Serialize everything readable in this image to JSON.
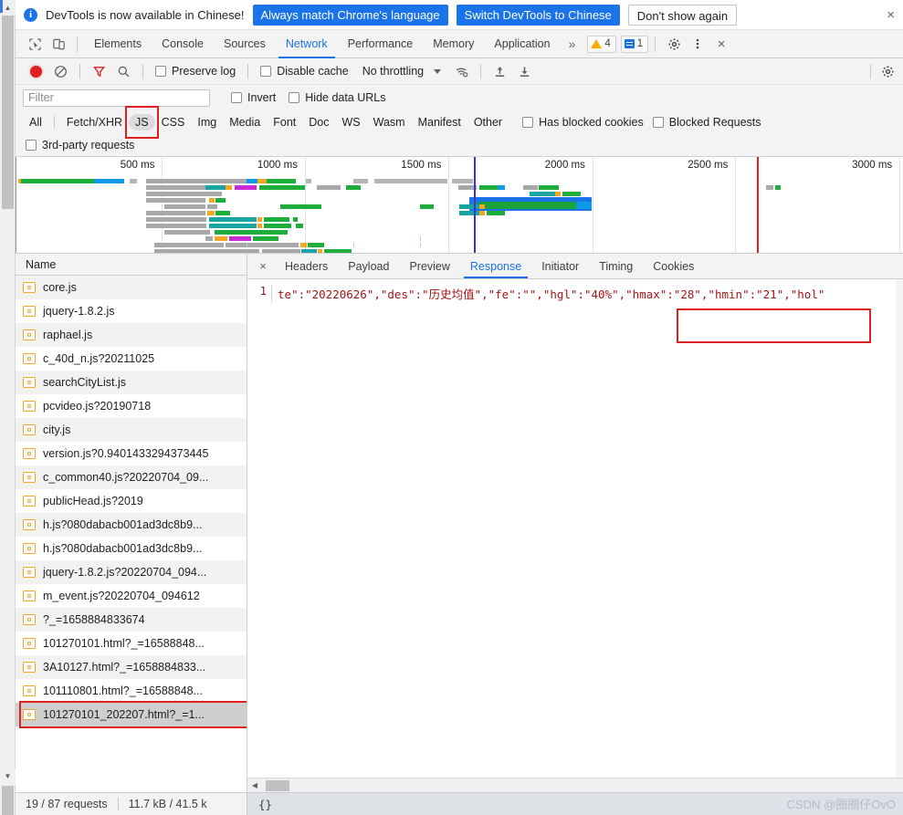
{
  "notification": {
    "icon": "info-icon",
    "message": "DevTools is now available in Chinese!",
    "primary_button": "Always match Chrome's language",
    "secondary_button": "Switch DevTools to Chinese",
    "dismiss_button": "Don't show again",
    "close_icon": "×",
    "accent_color": "#1a73e8"
  },
  "panel_tabs": {
    "inspect_icon": "inspect-cursor-icon",
    "device_icon": "device-toolbar-icon",
    "items": [
      {
        "label": "Elements",
        "active": false
      },
      {
        "label": "Console",
        "active": false
      },
      {
        "label": "Sources",
        "active": false
      },
      {
        "label": "Network",
        "active": true
      },
      {
        "label": "Performance",
        "active": false
      },
      {
        "label": "Memory",
        "active": false
      },
      {
        "label": "Application",
        "active": false
      }
    ],
    "more_icon": "chevron-double-right-icon",
    "warning_count": "4",
    "message_count": "1",
    "settings_icon": "gear-icon",
    "kebab_icon": "more-vertical-icon",
    "close_icon": "×"
  },
  "network_controls": {
    "record_icon": "record-button",
    "clear_icon": "clear-icon",
    "filter_icon": "filter-funnel-icon",
    "search_icon": "search-icon",
    "preserve_log_label": "Preserve log",
    "preserve_log_checked": false,
    "disable_cache_label": "Disable cache",
    "disable_cache_checked": false,
    "throttling_value": "No throttling",
    "throttle_caret_icon": "chevron-down-icon",
    "wifi_icon": "network-conditions-icon",
    "import_icon": "upload-har-icon",
    "export_icon": "download-har-icon",
    "settings_icon": "gear-icon"
  },
  "filter_bar": {
    "placeholder": "Filter",
    "value": "",
    "invert_label": "Invert",
    "invert_checked": false,
    "hide_data_urls_label": "Hide data URLs",
    "hide_data_urls_checked": false
  },
  "type_filters": {
    "items": [
      {
        "label": "All",
        "selected": false
      },
      {
        "label": "Fetch/XHR",
        "selected": false
      },
      {
        "label": "JS",
        "selected": true,
        "highlighted": true
      },
      {
        "label": "CSS",
        "selected": false
      },
      {
        "label": "Img",
        "selected": false
      },
      {
        "label": "Media",
        "selected": false
      },
      {
        "label": "Font",
        "selected": false
      },
      {
        "label": "Doc",
        "selected": false
      },
      {
        "label": "WS",
        "selected": false
      },
      {
        "label": "Wasm",
        "selected": false
      },
      {
        "label": "Manifest",
        "selected": false
      },
      {
        "label": "Other",
        "selected": false
      }
    ],
    "has_blocked_cookies_label": "Has blocked cookies",
    "has_blocked_cookies_checked": false,
    "blocked_requests_label": "Blocked Requests",
    "blocked_requests_checked": false,
    "third_party_label": "3rd-party requests",
    "third_party_checked": false,
    "highlight_color": "#e02020"
  },
  "overview": {
    "tick_labels": [
      "500 ms",
      "1000 ms",
      "1500 ms",
      "2000 ms",
      "2500 ms",
      "3000 ms"
    ],
    "dom_content_loaded_color": "#3b33cc",
    "load_event_color": "#e02020",
    "selected_bar_color": "#1a73e8"
  },
  "request_list": {
    "column_header": "Name",
    "rows": [
      {
        "name": "core.js"
      },
      {
        "name": "jquery-1.8.2.js"
      },
      {
        "name": "raphael.js"
      },
      {
        "name": "c_40d_n.js?20211025"
      },
      {
        "name": "searchCityList.js"
      },
      {
        "name": "pcvideo.js?20190718"
      },
      {
        "name": "city.js"
      },
      {
        "name": "version.js?0.9401433294373445"
      },
      {
        "name": "c_common40.js?20220704_09..."
      },
      {
        "name": "publicHead.js?2019"
      },
      {
        "name": "h.js?080dabacb001ad3dc8b9..."
      },
      {
        "name": "h.js?080dabacb001ad3dc8b9..."
      },
      {
        "name": "jquery-1.8.2.js?20220704_094..."
      },
      {
        "name": "m_event.js?20220704_094612"
      },
      {
        "name": "?_=1658884833674"
      },
      {
        "name": "101270101.html?_=16588848..."
      },
      {
        "name": "3A10127.html?_=1658884833..."
      },
      {
        "name": "101110801.html?_=16588848..."
      },
      {
        "name": "101270101_202207.html?_=1...",
        "selected": true,
        "highlighted": true
      }
    ],
    "status_requests": "19 / 87 requests",
    "status_transfer": "11.7 kB / 41.5 k"
  },
  "detail_pane": {
    "close_icon": "×",
    "tabs": [
      {
        "label": "Headers",
        "active": false
      },
      {
        "label": "Payload",
        "active": false
      },
      {
        "label": "Preview",
        "active": false
      },
      {
        "label": "Response",
        "active": true
      },
      {
        "label": "Initiator",
        "active": false
      },
      {
        "label": "Timing",
        "active": false
      },
      {
        "label": "Cookies",
        "active": false
      }
    ],
    "line_number": "1",
    "response_text": "te\":\"20220626\",\"des\":\"历史均值\",\"fe\":\"\",\"hgl\":\"40%\",\"hmax\":\"28\",\"hmin\":\"21\",\"hol\"",
    "highlight_start_token": "\"hmax\":\"28\",\"hmin\":\"21\",",
    "footer_text": "{}",
    "highlight_color": "#e02020"
  },
  "watermark": "CSDN @圈圈仔OvO"
}
